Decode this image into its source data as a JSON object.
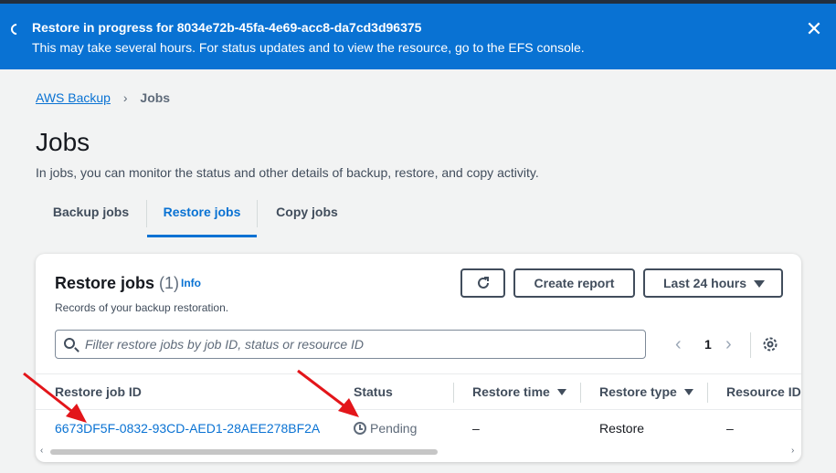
{
  "flash": {
    "title": "Restore in progress for 8034e72b-45fa-4e69-acc8-da7cd3d96375",
    "message": "This may take several hours. For status updates and to view the resource, go to the EFS console.",
    "close_icon": "close-icon"
  },
  "breadcrumb": {
    "root": "AWS Backup",
    "current": "Jobs"
  },
  "page": {
    "title": "Jobs",
    "description": "In jobs, you can monitor the status and other details of backup, restore, and copy activity."
  },
  "tabs": [
    {
      "label": "Backup jobs",
      "active": false
    },
    {
      "label": "Restore jobs",
      "active": true
    },
    {
      "label": "Copy jobs",
      "active": false
    }
  ],
  "panel": {
    "title": "Restore jobs",
    "count": "(1)",
    "info": "Info",
    "description": "Records of your backup restoration.",
    "create_report": "Create report",
    "time_range": "Last 24 hours",
    "search_placeholder": "Filter restore jobs by job ID, status or resource ID",
    "page_number": "1"
  },
  "table": {
    "columns": [
      "Restore job ID",
      "Status",
      "Restore time",
      "Restore type",
      "Resource ID"
    ],
    "rows": [
      {
        "restore_job_id": "6673DF5F-0832-93CD-AED1-28AEE278BF2A",
        "status": "Pending",
        "restore_time": "–",
        "restore_type": "Restore",
        "resource_id": "–"
      }
    ]
  },
  "colors": {
    "flash_bg": "#0972d3",
    "link": "#0972d3",
    "annotation_arrow": "#e3151a"
  }
}
